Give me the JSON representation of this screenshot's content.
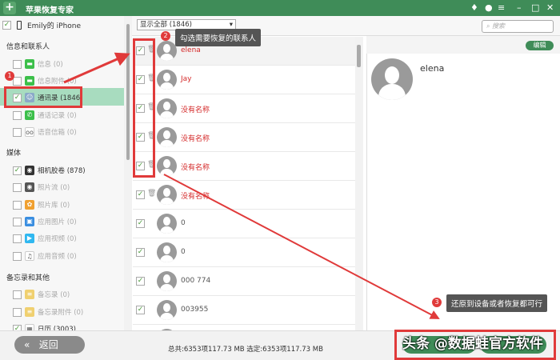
{
  "app": {
    "title": "苹果恢复专家",
    "logo": "+"
  },
  "window_controls": {
    "vip": "♦",
    "chat": "●",
    "menu": "≡",
    "min": "–",
    "max": "□",
    "close": "✕"
  },
  "device": {
    "name": "Emily的 iPhone"
  },
  "sidebar": {
    "sections": [
      {
        "title": "信息和联系人"
      },
      {
        "title": "媒体"
      },
      {
        "title": "备忘录和其他"
      }
    ],
    "items": [
      {
        "label": "信息 (0)",
        "checked": false,
        "color": "#3cbf4a",
        "glyph": "▬"
      },
      {
        "label": "信息附件 (0)",
        "checked": false,
        "color": "#3cbf4a",
        "glyph": "▬"
      },
      {
        "label": "通讯录 (1846)",
        "checked": true,
        "color": "#8aa9c8",
        "glyph": "☺"
      },
      {
        "label": "通话记录 (0)",
        "checked": false,
        "color": "#3cbf4a",
        "glyph": "✆"
      },
      {
        "label": "语音信箱 (0)",
        "checked": false,
        "color": "#fff",
        "glyph": "oo"
      },
      {
        "label": "相机胶卷 (878)",
        "checked": true,
        "color": "#333",
        "glyph": "◉"
      },
      {
        "label": "照片流 (0)",
        "checked": false,
        "color": "#555",
        "glyph": "◉"
      },
      {
        "label": "照片库 (0)",
        "checked": false,
        "color": "#f0a030",
        "glyph": "✿"
      },
      {
        "label": "应用图片 (0)",
        "checked": false,
        "color": "#3a8ee0",
        "glyph": "▣"
      },
      {
        "label": "应用视频 (0)",
        "checked": false,
        "color": "#30b8f0",
        "glyph": "▶"
      },
      {
        "label": "应用音频 (0)",
        "checked": false,
        "color": "#fff",
        "glyph": "♫"
      },
      {
        "label": "备忘录 (0)",
        "checked": false,
        "color": "#f0d070",
        "glyph": "≡"
      },
      {
        "label": "备忘录附件 (0)",
        "checked": false,
        "color": "#f0d070",
        "glyph": "≡"
      },
      {
        "label": "日历 (3003)",
        "checked": true,
        "color": "#fff",
        "glyph": "▦"
      }
    ]
  },
  "toolbar": {
    "filter": "显示全部 (1846)",
    "search_placeholder": "搜索"
  },
  "contacts": [
    {
      "name": "elena",
      "red": true,
      "trash": true
    },
    {
      "name": "Jay",
      "red": true,
      "trash": true
    },
    {
      "name": "没有名称",
      "red": true,
      "trash": true
    },
    {
      "name": "没有名称",
      "red": true,
      "trash": true
    },
    {
      "name": "没有名称",
      "red": true,
      "trash": true
    },
    {
      "name": "没有名称",
      "red": true,
      "trash": true
    },
    {
      "name": "0",
      "red": false,
      "trash": false
    },
    {
      "name": "0",
      "red": false,
      "trash": false
    },
    {
      "name": "000 774",
      "red": false,
      "trash": false
    },
    {
      "name": "003955",
      "red": false,
      "trash": false
    },
    {
      "name": "",
      "red": false,
      "trash": false
    }
  ],
  "detail": {
    "name": "elena",
    "edit_label": "编辑"
  },
  "annotations": {
    "step1": "1",
    "step2": "2",
    "step2_text": "勾选需要恢复的联系人",
    "step3": "3",
    "step3_text": "还原到设备或者恢复都可行",
    "watermark": "头条 @数据蛙官方软件"
  },
  "footer": {
    "back_label": "返回",
    "back_icon": "«",
    "status": "总共:6353项117.73 MB 选定:6353项117.73 MB"
  }
}
